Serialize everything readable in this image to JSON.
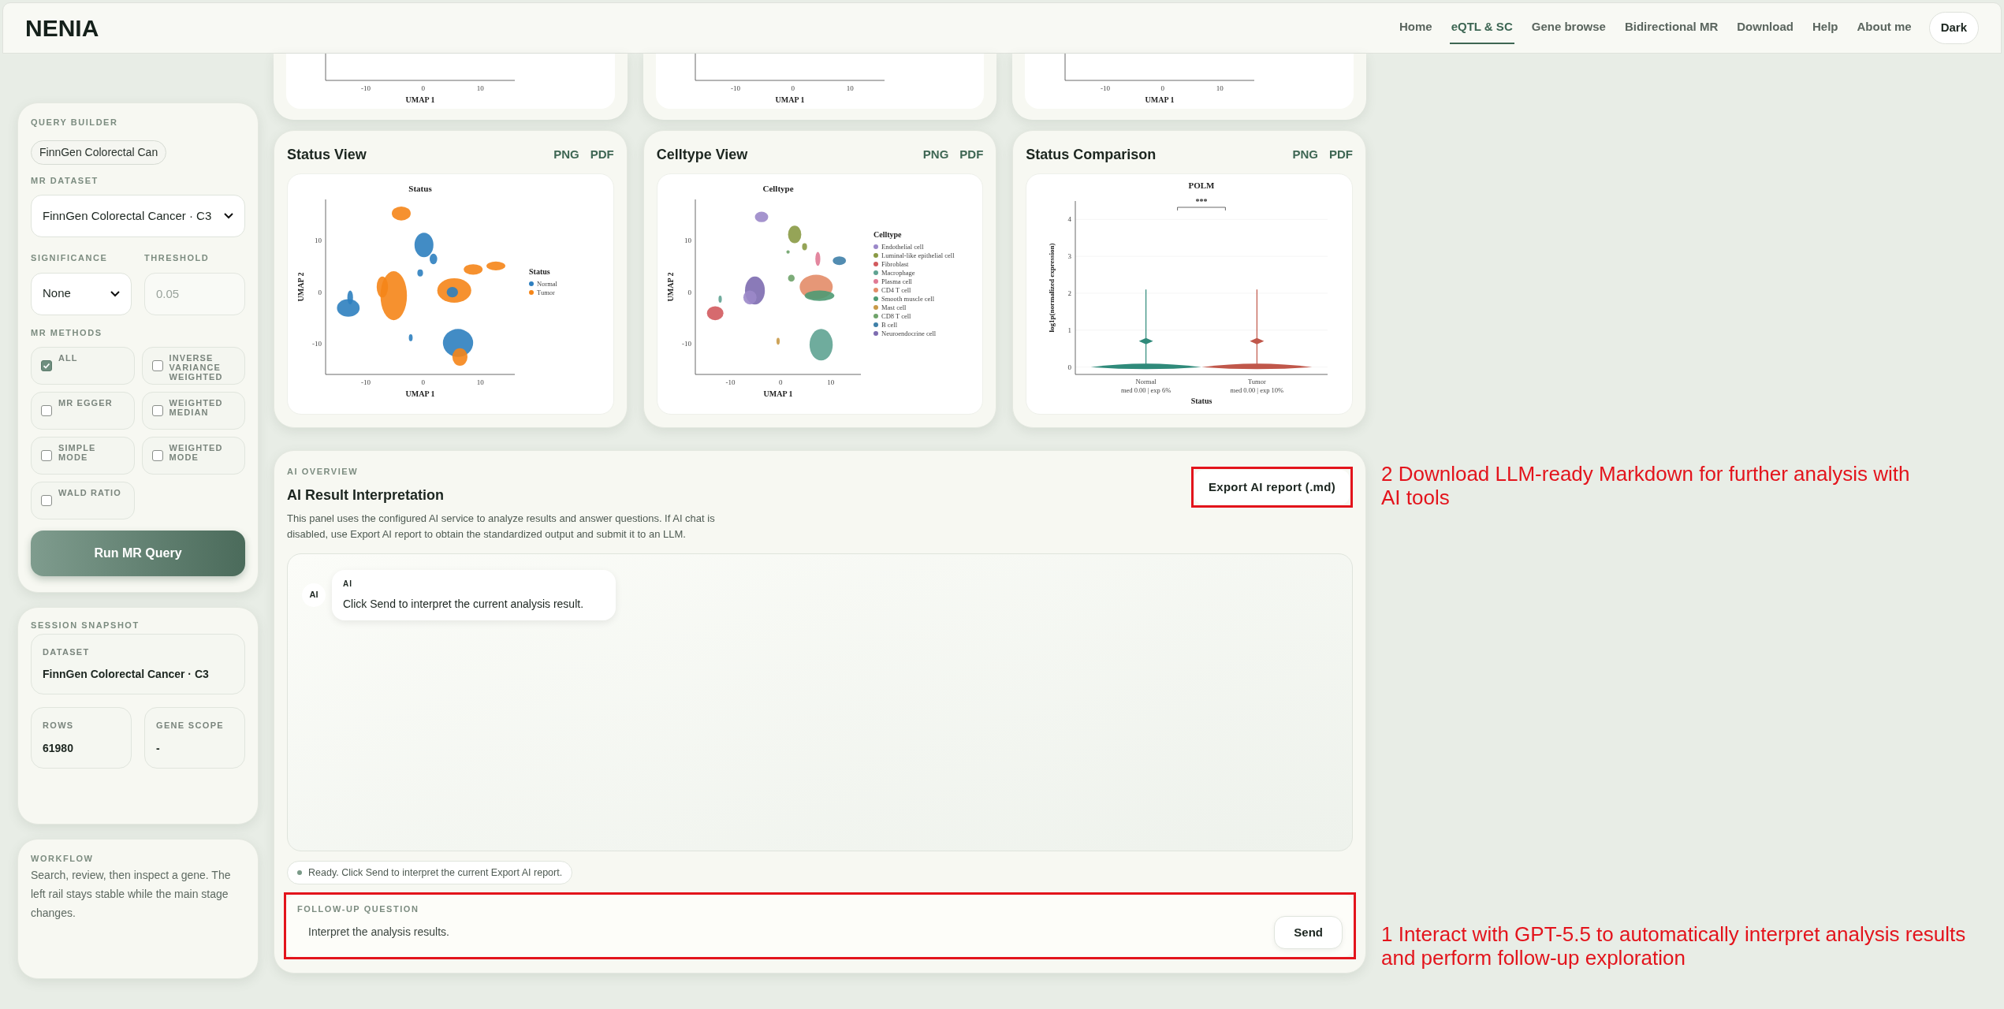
{
  "header": {
    "brand": "NENIA",
    "nav": [
      {
        "label": "Home",
        "selected": false
      },
      {
        "label": "eQTL & SC",
        "selected": true
      },
      {
        "label": "Gene browse",
        "selected": false
      },
      {
        "label": "Bidirectional MR",
        "selected": false
      },
      {
        "label": "Download",
        "selected": false
      },
      {
        "label": "Help",
        "selected": false
      },
      {
        "label": "About me",
        "selected": false
      }
    ],
    "theme_button": "Dark"
  },
  "sidebar": {
    "query_builder": {
      "title": "QUERY BUILDER",
      "chip": "FinnGen Colorectal Can",
      "dataset_label": "MR DATASET",
      "dataset_value": "FinnGen Colorectal Cancer · C3",
      "significance_label": "SIGNIFICANCE",
      "significance_value": "None",
      "threshold_label": "THRESHOLD",
      "threshold_placeholder": "0.05",
      "methods_label": "MR METHODS",
      "methods": [
        {
          "label": "ALL",
          "checked": true
        },
        {
          "label": "INVERSE VARIANCE WEIGHTED",
          "checked": false
        },
        {
          "label": "MR EGGER",
          "checked": false
        },
        {
          "label": "WEIGHTED MEDIAN",
          "checked": false
        },
        {
          "label": "SIMPLE MODE",
          "checked": false
        },
        {
          "label": "WEIGHTED MODE",
          "checked": false
        },
        {
          "label": "WALD RATIO",
          "checked": false
        }
      ],
      "run_button": "Run MR Query"
    },
    "session": {
      "title": "SESSION SNAPSHOT",
      "fields": [
        {
          "label": "DATASET",
          "value": "FinnGen Colorectal Cancer · C3"
        },
        {
          "label": "ROWS",
          "value": "61980"
        },
        {
          "label": "GENE SCOPE",
          "value": "-"
        }
      ]
    },
    "workflow": {
      "title": "WORKFLOW",
      "text": "Search, review, then inspect a gene. The left rail stays stable while the main stage changes."
    }
  },
  "top_plots": [
    {
      "xticks": [
        "-10",
        "0",
        "10"
      ],
      "xlabel": "UMAP 1"
    },
    {
      "xticks": [
        "-10",
        "0",
        "10"
      ],
      "xlabel": "UMAP 1"
    },
    {
      "xticks": [
        "-10",
        "0",
        "10"
      ],
      "xlabel": "UMAP 1"
    }
  ],
  "plot_cards": [
    {
      "title": "Status View",
      "actions": [
        "PNG",
        "PDF"
      ],
      "plot": {
        "kind": "status_umap",
        "title": "Status",
        "xlabel": "UMAP 1",
        "ylabel": "UMAP 2",
        "xticks": [
          "-10",
          "0",
          "10"
        ],
        "yticks": [
          "10",
          "0",
          "-10"
        ],
        "legend_title": "Status",
        "legend": [
          {
            "label": "Normal",
            "color": "#2e7fbf"
          },
          {
            "label": "Tumor",
            "color": "#f58518"
          }
        ]
      }
    },
    {
      "title": "Celltype View",
      "actions": [
        "PNG",
        "PDF"
      ],
      "plot": {
        "kind": "celltype_umap",
        "title": "Celltype",
        "xlabel": "UMAP 1",
        "ylabel": "UMAP 2",
        "xticks": [
          "-10",
          "0",
          "10"
        ],
        "yticks": [
          "10",
          "0",
          "-10"
        ],
        "legend_title": "Celltype",
        "legend": [
          {
            "label": "Endothelial cell",
            "color": "#9b88c9"
          },
          {
            "label": "Luminal-like epithelial cell",
            "color": "#8a9a45"
          },
          {
            "label": "Fibroblast",
            "color": "#d25a5e"
          },
          {
            "label": "Macrophage",
            "color": "#5fa392"
          },
          {
            "label": "Plasma cell",
            "color": "#e07a95"
          },
          {
            "label": "CD4 T cell",
            "color": "#e38c68"
          },
          {
            "label": "Smooth muscle cell",
            "color": "#4e9a73"
          },
          {
            "label": "Mast cell",
            "color": "#c99a48"
          },
          {
            "label": "CD8 T cell",
            "color": "#6fa36a"
          },
          {
            "label": "B cell",
            "color": "#3f80a8"
          },
          {
            "label": "Neuroendocrine cell",
            "color": "#7d6cb0"
          }
        ]
      }
    },
    {
      "title": "Status Comparison",
      "actions": [
        "PNG",
        "PDF"
      ],
      "plot": {
        "kind": "violin",
        "title": "POLM",
        "xlabel": "Status",
        "ylabel": "log1p(normalized expression)",
        "yticks": [
          "4",
          "3",
          "2",
          "1",
          "0"
        ],
        "significance": "***",
        "groups": [
          {
            "label": "Normal",
            "note": "med 0.00 | exp 6%",
            "color": "#2f8a7a"
          },
          {
            "label": "Tumor",
            "note": "med 0.00 | exp 10%",
            "color": "#c0574a"
          }
        ]
      }
    }
  ],
  "ai_panel": {
    "eyebrow": "AI OVERVIEW",
    "title": "AI Result Interpretation",
    "description": "This panel uses the configured AI service to analyze results and answer questions. If AI chat is disabled, use Export AI report to obtain the standardized output and submit it to an LLM.",
    "export_button": "Export AI report (.md)",
    "messages": [
      {
        "avatar": "AI",
        "sender": "AI",
        "text": "Click Send to interpret the current analysis result."
      }
    ],
    "status": "Ready. Click Send to interpret the current Export AI report.",
    "followup_label": "FOLLOW-UP QUESTION",
    "followup_value": "Interpret the analysis results.",
    "send_button": "Send"
  },
  "annotations": [
    {
      "text": "2 Download LLM-ready Markdown for further analysis with AI tools"
    },
    {
      "text": "1 Interact with GPT-5.5 to automatically interpret analysis results and perform follow-up exploration"
    }
  ]
}
